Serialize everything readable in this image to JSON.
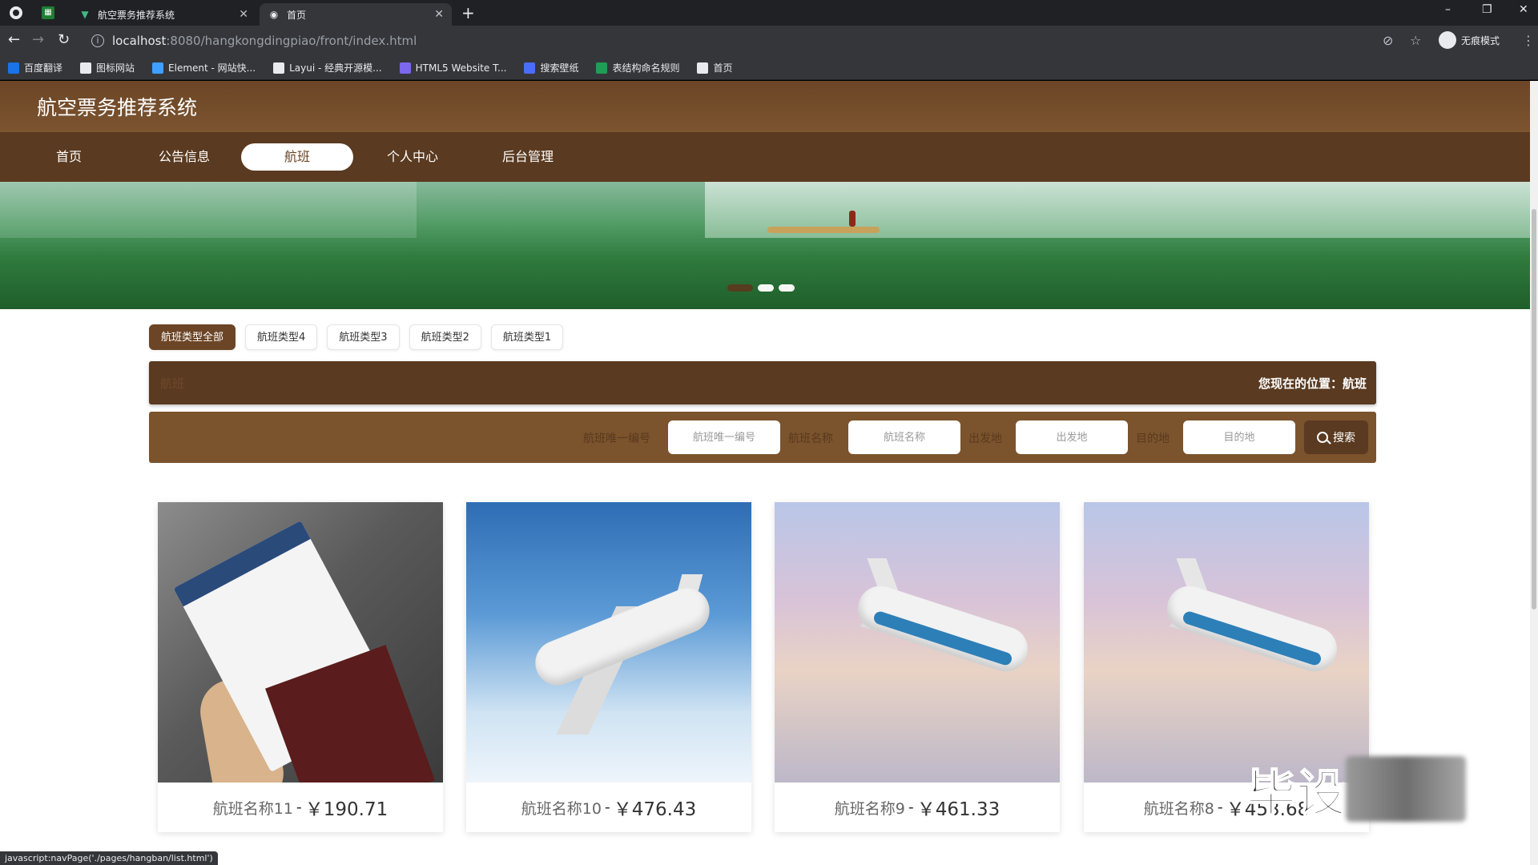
{
  "browser": {
    "tabs": [
      {
        "title": "航空票务推荐系统"
      },
      {
        "title": "首页"
      }
    ],
    "url_host": "localhost",
    "url_path": ":8080/hangkongdingpiao/front/index.html",
    "incognito_label": "无痕模式",
    "bookmarks": [
      {
        "label": "百度翻译",
        "icon": "translate-icon",
        "color": "#1a73e8"
      },
      {
        "label": "图标网站",
        "icon": "flag-icon",
        "color": "#e8eaed"
      },
      {
        "label": "Element - 网站快...",
        "icon": "element-icon",
        "color": "#409eff"
      },
      {
        "label": "Layui - 经典开源模...",
        "icon": "layui-icon",
        "color": "#e8eaed"
      },
      {
        "label": "HTML5 Website T...",
        "icon": "html5-icon",
        "color": "#7b68ee"
      },
      {
        "label": "搜索壁纸",
        "icon": "wallpaper-icon",
        "color": "#4a6cf7"
      },
      {
        "label": "表结构命名规则",
        "icon": "table-icon",
        "color": "#1e9e55"
      },
      {
        "label": "首页",
        "icon": "globe-icon",
        "color": "#e8eaed"
      }
    ],
    "status_text": "javascript:navPage('./pages/hangban/list.html')"
  },
  "site": {
    "title": "航空票务推荐系统",
    "nav": [
      {
        "label": "首页"
      },
      {
        "label": "公告信息"
      },
      {
        "label": "航班"
      },
      {
        "label": "个人中心"
      },
      {
        "label": "后台管理"
      }
    ],
    "active_nav": "航班",
    "brand_color": "#6b4526"
  },
  "carousel": {
    "slides": 3,
    "active_index": 0
  },
  "type_tabs": [
    {
      "label": "航班类型全部"
    },
    {
      "label": "航班类型4"
    },
    {
      "label": "航班类型3"
    },
    {
      "label": "航班类型2"
    },
    {
      "label": "航班类型1"
    }
  ],
  "location_bar": {
    "left": "航班",
    "right": "您现在的位置：航班"
  },
  "search": {
    "fields": [
      {
        "label": "航班唯一编号",
        "placeholder": "航班唯一编号"
      },
      {
        "label": "航班名称",
        "placeholder": "航班名称"
      },
      {
        "label": "出发地",
        "placeholder": "出发地"
      },
      {
        "label": "目的地",
        "placeholder": "目的地"
      }
    ],
    "button_label": "搜索"
  },
  "cards": [
    {
      "name": "航班名称11",
      "sep": "-",
      "price": "￥190.71",
      "image": "ticket-photo"
    },
    {
      "name": "航班名称10",
      "sep": "-",
      "price": "￥476.43",
      "image": "airplane-photo"
    },
    {
      "name": "航班名称9",
      "sep": "-",
      "price": "￥461.33",
      "image": "airplane-photo"
    },
    {
      "name": "航班名称8",
      "sep": "-",
      "price": "￥453.68",
      "image": "airplane-photo"
    }
  ],
  "watermark": {
    "text": "毕设"
  }
}
